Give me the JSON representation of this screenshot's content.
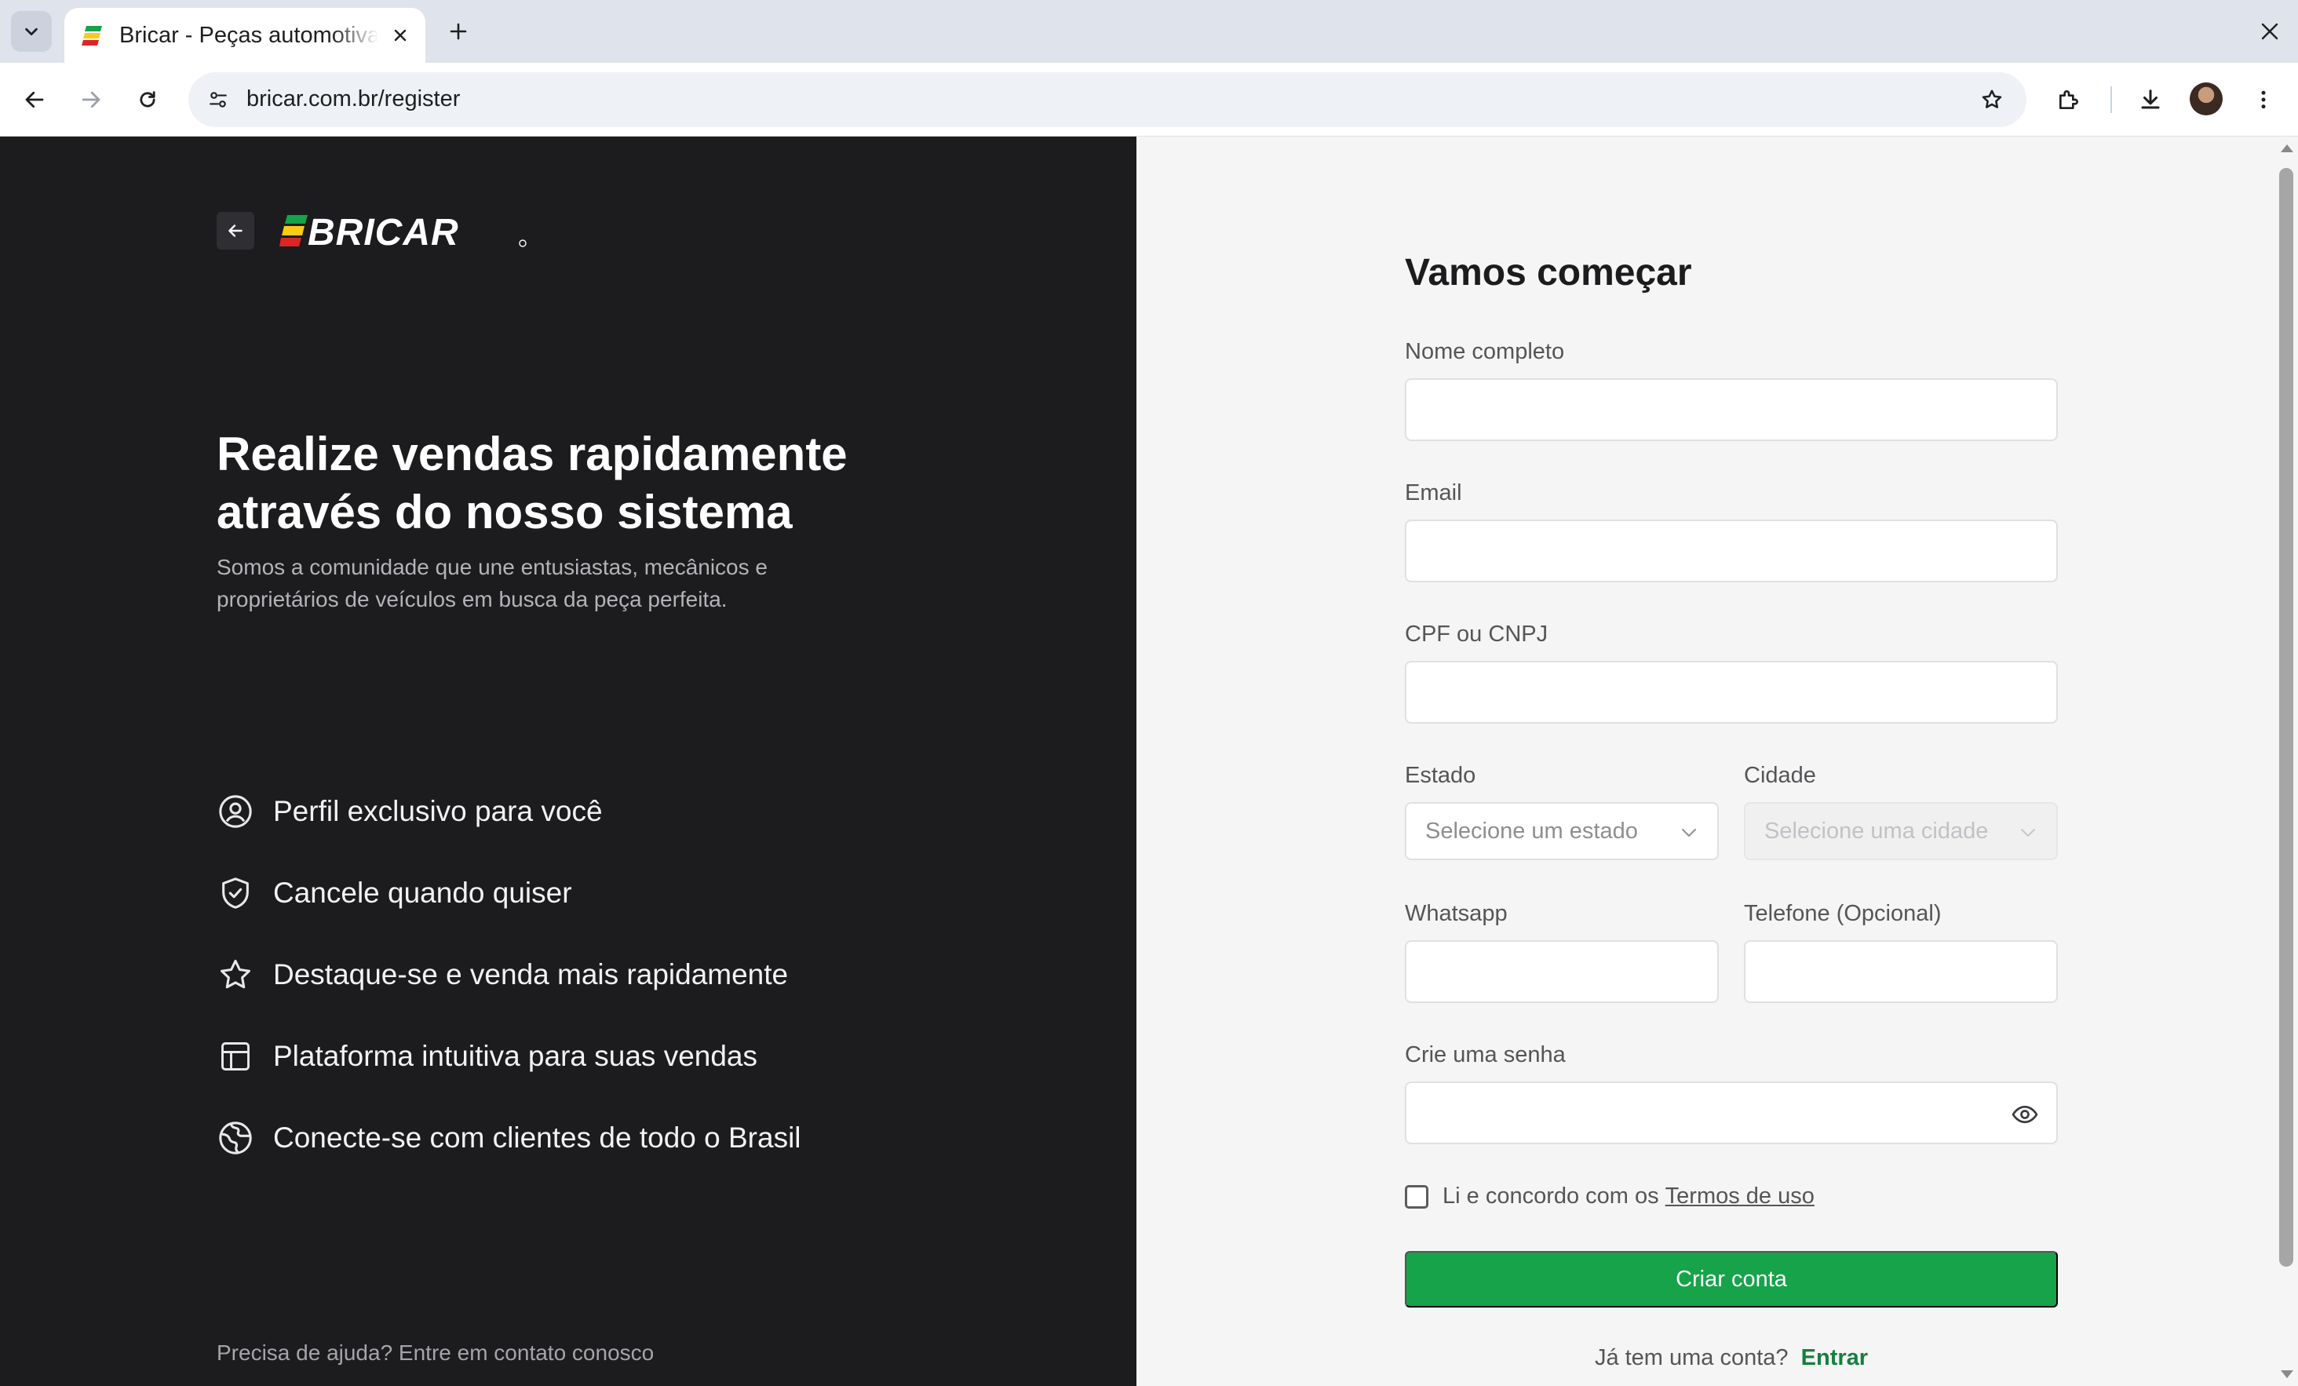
{
  "browser": {
    "tab_title": "Bricar - Peças automotivas",
    "url": "bricar.com.br/register",
    "favicon_colors": [
      "#16a34a",
      "#facc15",
      "#dc2626"
    ]
  },
  "left": {
    "logo_text": "BRICAR",
    "hero_title_line1": "Realize vendas rapidamente",
    "hero_title_line2": "através do nosso sistema",
    "hero_sub_line1": "Somos a comunidade que une entusiastas, mecânicos e",
    "hero_sub_line2": "proprietários de veículos em busca da peça perfeita.",
    "features": [
      {
        "icon": "user-circle-icon",
        "label": "Perfil exclusivo para você"
      },
      {
        "icon": "shield-check-icon",
        "label": "Cancele quando quiser"
      },
      {
        "icon": "star-icon",
        "label": "Destaque-se e venda mais rapidamente"
      },
      {
        "icon": "layout-icon",
        "label": "Plataforma intuitiva para suas vendas"
      },
      {
        "icon": "globe-icon",
        "label": "Conecte-se com clientes de todo o Brasil"
      }
    ],
    "help_text": "Precisa de ajuda? Entre em contato conosco"
  },
  "form": {
    "title": "Vamos começar",
    "name_label": "Nome completo",
    "email_label": "Email",
    "doc_label": "CPF ou CNPJ",
    "state_label": "Estado",
    "state_placeholder": "Selecione um estado",
    "city_label": "Cidade",
    "city_placeholder": "Selecione uma cidade",
    "whatsapp_label": "Whatsapp",
    "phone_label": "Telefone (Opcional)",
    "password_label": "Crie uma senha",
    "terms_text": "Li e concordo com os",
    "terms_link": "Termos de uso",
    "submit_label": "Criar conta",
    "login_prompt": "Já tem uma conta?",
    "login_link": "Entrar"
  },
  "colors": {
    "left_bg": "#1c1c1e",
    "right_bg": "#f5f5f5",
    "primary_green": "#16a34a",
    "link_green": "#15803d",
    "logo_stripes": [
      "#16a34a",
      "#facc15",
      "#dc2626"
    ]
  }
}
